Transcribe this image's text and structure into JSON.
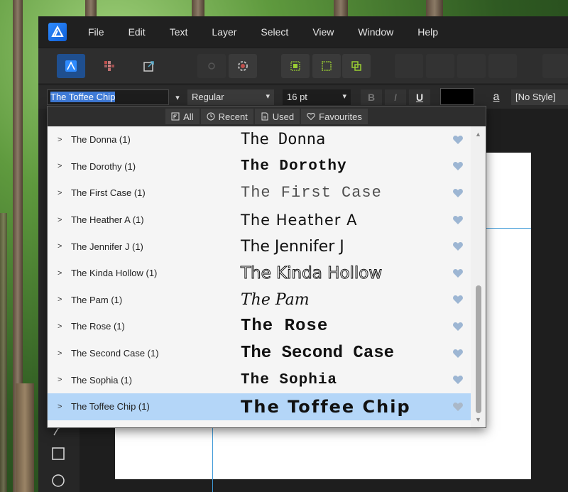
{
  "menubar": {
    "items": [
      "File",
      "Edit",
      "Text",
      "Layer",
      "Select",
      "View",
      "Window",
      "Help"
    ]
  },
  "context_bar": {
    "font_name": "The Toffee Chip",
    "font_style": "Regular",
    "font_size": "16 pt",
    "bold": "B",
    "italic": "I",
    "underline": "U",
    "color_swatch": "#000000",
    "char_style_icon": "a",
    "paragraph_style": "[No Style]"
  },
  "font_popup": {
    "filters": [
      {
        "label": "All",
        "icon": "font-file-icon"
      },
      {
        "label": "Recent",
        "icon": "clock-icon"
      },
      {
        "label": "Used",
        "icon": "document-icon"
      },
      {
        "label": "Favourites",
        "icon": "heart-outline-icon"
      }
    ],
    "fonts": [
      {
        "label": "The Donna (1)",
        "preview": "The Donna",
        "selected": false
      },
      {
        "label": "The Dorothy (1)",
        "preview": "The Dorothy",
        "selected": false
      },
      {
        "label": "The First Case (1)",
        "preview": "The First Case",
        "selected": false
      },
      {
        "label": "The Heather A (1)",
        "preview": "The Heather A",
        "selected": false
      },
      {
        "label": "The Jennifer J (1)",
        "preview": "The Jennifer J",
        "selected": false
      },
      {
        "label": "The Kinda Hollow (1)",
        "preview": "The Kinda Hollow",
        "selected": false
      },
      {
        "label": "The Pam (1)",
        "preview": "The Pam",
        "selected": false
      },
      {
        "label": "The Rose (1)",
        "preview": "The Rose",
        "selected": false
      },
      {
        "label": "The Second Case (1)",
        "preview": "The Second Case",
        "selected": false
      },
      {
        "label": "The Sophia (1)",
        "preview": "The Sophia",
        "selected": false
      },
      {
        "label": "The Toffee Chip (1)",
        "preview": "The Toffee Chip",
        "selected": true
      }
    ]
  },
  "colors": {
    "accent": "#3f7bd8",
    "selection_row": "#b4d6f8",
    "heart": "#9db6d3",
    "guide": "#3f9ad8"
  }
}
